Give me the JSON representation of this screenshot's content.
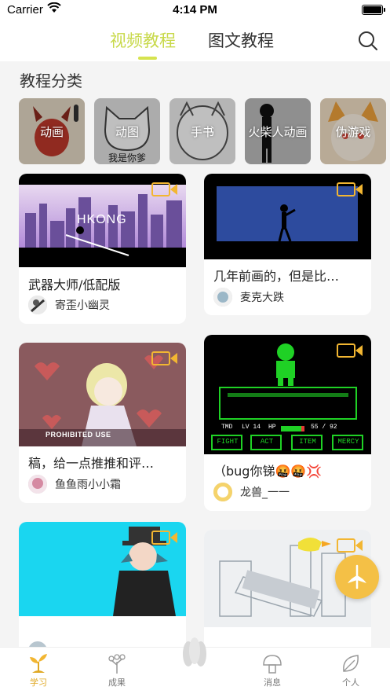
{
  "status": {
    "carrier": "Carrier",
    "time": "4:14 PM"
  },
  "nav": {
    "tab_video": "视频教程",
    "tab_text": "图文教程"
  },
  "section": {
    "title": "教程分类"
  },
  "categories": [
    {
      "label": "动画"
    },
    {
      "label": "动图"
    },
    {
      "label": "手书"
    },
    {
      "label": "火柴人动画"
    },
    {
      "label": "伪游戏"
    }
  ],
  "cards": [
    {
      "title": "武器大师/低配版",
      "author": "寄歪小幽灵",
      "thumb_text": "HKONG"
    },
    {
      "title": "几年前画的，但是比…",
      "author": "麦克大跌"
    },
    {
      "title": "稿，给一点推推和评…",
      "author": "鱼鱼雨小小霜",
      "thumb_text": "PROHIBITED USE"
    },
    {
      "title": "（bug你锑🤬🤬💢",
      "author": "龙兽_一一",
      "hud": [
        "TMD",
        "LV 14",
        "HP",
        "55 / 92"
      ],
      "buttons": [
        "FIGHT",
        "ACT",
        "ITEM",
        "MERCY"
      ]
    },
    {
      "title": "",
      "author": ""
    },
    {
      "title": "",
      "author": ""
    }
  ],
  "bottom": {
    "learn": "学习",
    "results": "成果",
    "messages": "消息",
    "profile": "个人"
  },
  "colors": {
    "accent": "#d6e34f",
    "active_tab": "#e0a823",
    "fab": "#f4c046"
  }
}
